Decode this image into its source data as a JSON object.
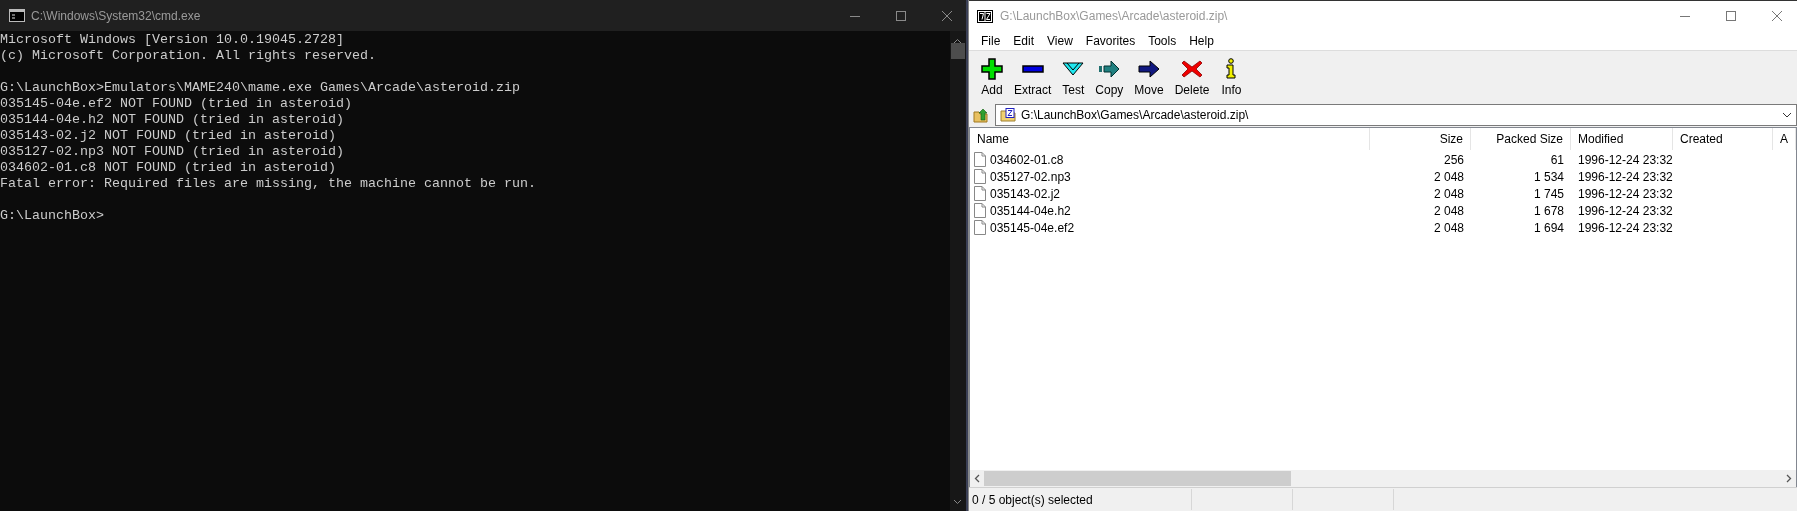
{
  "console": {
    "title": "C:\\Windows\\System32\\cmd.exe",
    "blocks": [
      [
        "Microsoft Windows [Version 10.0.19045.2728]",
        "(c) Microsoft Corporation. All rights reserved."
      ],
      [
        "G:\\LaunchBox>Emulators\\MAME240\\mame.exe Games\\Arcade\\asteroid.zip",
        "035145-04e.ef2 NOT FOUND (tried in asteroid)",
        "035144-04e.h2 NOT FOUND (tried in asteroid)",
        "035143-02.j2 NOT FOUND (tried in asteroid)",
        "035127-02.np3 NOT FOUND (tried in asteroid)",
        "034602-01.c8 NOT FOUND (tried in asteroid)",
        "Fatal error: Required files are missing, the machine cannot be run."
      ],
      [
        "G:\\LaunchBox>"
      ]
    ]
  },
  "archiver": {
    "title": "G:\\LaunchBox\\Games\\Arcade\\asteroid.zip\\",
    "menu": [
      "File",
      "Edit",
      "View",
      "Favorites",
      "Tools",
      "Help"
    ],
    "toolbar": [
      {
        "label": "Add",
        "kind": "add"
      },
      {
        "label": "Extract",
        "kind": "extract"
      },
      {
        "label": "Test",
        "kind": "test"
      },
      {
        "label": "Copy",
        "kind": "copy"
      },
      {
        "label": "Move",
        "kind": "move"
      },
      {
        "label": "Delete",
        "kind": "delete"
      },
      {
        "label": "Info",
        "kind": "info"
      }
    ],
    "address": "G:\\LaunchBox\\Games\\Arcade\\asteroid.zip\\",
    "columns": [
      "Name",
      "Size",
      "Packed Size",
      "Modified",
      "Created",
      "A"
    ],
    "rows": [
      {
        "name": "034602-01.c8",
        "size": "256",
        "packed": "61",
        "modified": "1996-12-24 23:32"
      },
      {
        "name": "035127-02.np3",
        "size": "2 048",
        "packed": "1 534",
        "modified": "1996-12-24 23:32"
      },
      {
        "name": "035143-02.j2",
        "size": "2 048",
        "packed": "1 745",
        "modified": "1996-12-24 23:32"
      },
      {
        "name": "035144-04e.h2",
        "size": "2 048",
        "packed": "1 678",
        "modified": "1996-12-24 23:32"
      },
      {
        "name": "035145-04e.ef2",
        "size": "2 048",
        "packed": "1 694",
        "modified": "1996-12-24 23:32"
      }
    ],
    "status": "0 / 5 object(s) selected"
  }
}
